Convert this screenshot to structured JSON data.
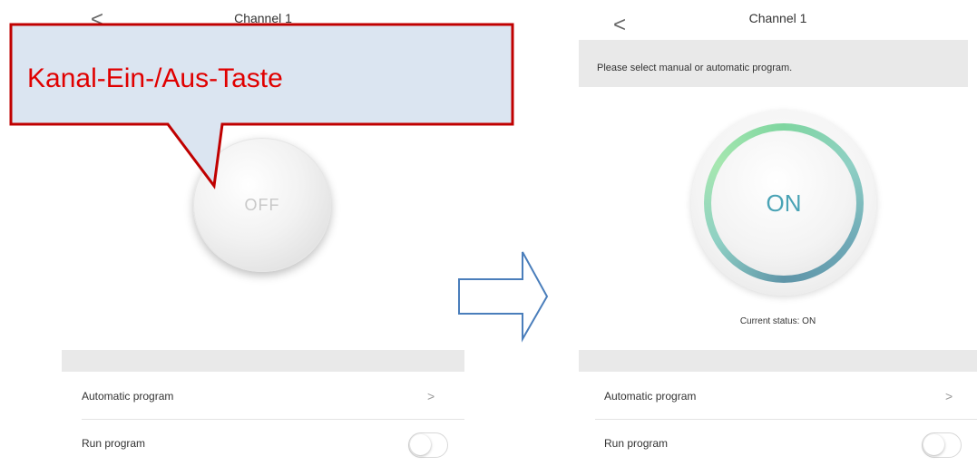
{
  "left_screen": {
    "title": "Channel 1",
    "back_glyph": "<",
    "power_button_label": "OFF",
    "rows": [
      {
        "label": "Automatic program",
        "accessory": "chevron-right",
        "glyph": ">"
      },
      {
        "label": "Run program",
        "accessory": "toggle",
        "toggle_on": false
      }
    ]
  },
  "right_screen": {
    "title": "Channel 1",
    "back_glyph": "<",
    "info_text": "Please select manual or automatic program.",
    "power_button_label": "ON",
    "status_text": "Current status: ON",
    "rows": [
      {
        "label": "Automatic program",
        "accessory": "chevron-right",
        "glyph": ">"
      },
      {
        "label": "Run program",
        "accessory": "toggle",
        "toggle_on": false
      }
    ]
  },
  "callout": {
    "text": "Kanal-Ein-/Aus-Taste",
    "text_color": "#e00000",
    "fill_color": "#dbe5f1",
    "border_color": "#c00000"
  },
  "arrow": {
    "icon": "right-arrow-outline",
    "color": "#4a7ebb"
  },
  "colors": {
    "on_accent": "#4aa3b5",
    "ring_green": "#7fd6a0",
    "section_gray": "#e9e9e9"
  }
}
